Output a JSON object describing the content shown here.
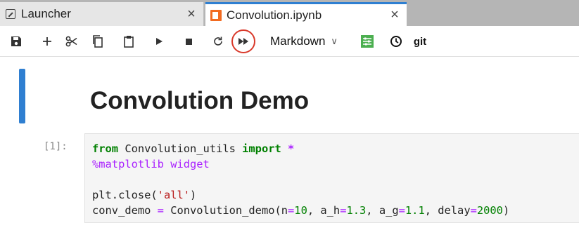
{
  "tabs": [
    {
      "label": "Launcher",
      "icon": "launcher-icon",
      "active": false
    },
    {
      "label": "Convolution.ipynb",
      "icon": "notebook-icon",
      "active": true
    }
  ],
  "tab_close_glyph": "×",
  "toolbar": {
    "buttons": [
      "save-icon",
      "add-cell-icon",
      "cut-icon",
      "copy-icon",
      "paste-icon",
      "run-icon",
      "stop-icon",
      "restart-icon",
      "run-all-icon",
      "property-inspector-icon",
      "history-icon"
    ],
    "cell_type": "Markdown",
    "git_label": "git",
    "highlight_color": "#d9392a",
    "accent_color": "#2f7fd1"
  },
  "notebook": {
    "heading": "Convolution Demo",
    "prompt": "[1]:",
    "code": {
      "l1_from": "from",
      "l1_module": " Convolution_utils ",
      "l1_import": "import",
      "l1_star": "*",
      "l2_magic": "%matplotlib widget",
      "l4_a": "plt.close(",
      "l4_str": "'all'",
      "l4_b": ")",
      "l5_a": "conv_demo ",
      "l5_eq": "=",
      "l5_b": " Convolution_demo(n",
      "l5_eq2": "=",
      "l5_n": "10",
      "l5_c": ", a_h",
      "l5_eq3": "=",
      "l5_ah": "1.3",
      "l5_d": ", a_g",
      "l5_eq4": "=",
      "l5_ag": "1.1",
      "l5_e": ", delay",
      "l5_eq5": "=",
      "l5_delay": "2000",
      "l5_f": ")"
    }
  }
}
